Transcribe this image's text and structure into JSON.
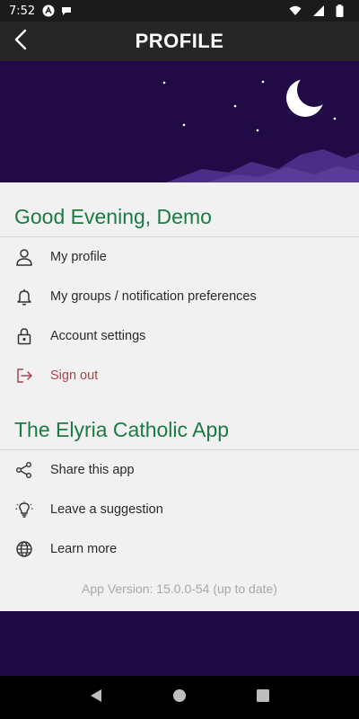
{
  "status_bar": {
    "time": "7:52",
    "icons": [
      "app-notification-icon",
      "chat-icon",
      "wifi-icon",
      "cell-signal-icon",
      "battery-icon"
    ]
  },
  "app_bar": {
    "title": "PROFILE",
    "back_icon": "chevron-left-icon"
  },
  "account_section": {
    "greeting": "Good Evening, Demo",
    "items": [
      {
        "label": "My profile",
        "icon": "person-icon"
      },
      {
        "label": "My groups / notification preferences",
        "icon": "bell-icon"
      },
      {
        "label": "Account settings",
        "icon": "lock-icon"
      },
      {
        "label": "Sign out",
        "icon": "sign-out-icon",
        "color": "#a2474c"
      }
    ]
  },
  "app_section": {
    "title": "The Elyria Catholic App",
    "items": [
      {
        "label": "Share this app",
        "icon": "share-icon"
      },
      {
        "label": "Leave a suggestion",
        "icon": "lightbulb-icon"
      },
      {
        "label": "Learn more",
        "icon": "globe-icon"
      }
    ]
  },
  "app_version": "App Version: 15.0.0-54 (up to date)",
  "colors": {
    "accent_green": "#1c7a43",
    "night_purple": "#220a47",
    "sign_out_red": "#a2474c"
  }
}
